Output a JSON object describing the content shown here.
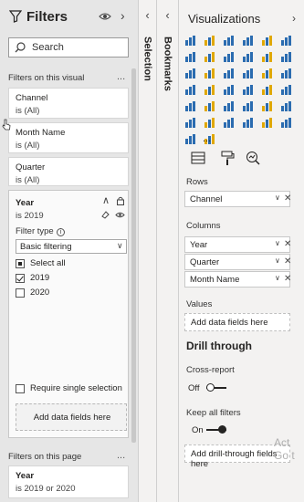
{
  "filters": {
    "title": "Filters",
    "search_placeholder": "Search",
    "section_visual": "Filters on this visual",
    "more": "...",
    "cards": [
      {
        "name": "Channel",
        "value": "is (All)"
      },
      {
        "name": "Month Name",
        "value": "is (All)"
      },
      {
        "name": "Quarter",
        "value": "is (All)"
      }
    ],
    "year": {
      "name": "Year",
      "value": "is 2019",
      "filter_type_label": "Filter type",
      "filter_type_value": "Basic filtering",
      "options": [
        {
          "label": "Select all",
          "state": "partial"
        },
        {
          "label": "2019",
          "state": "checked"
        },
        {
          "label": "2020",
          "state": "unchecked"
        }
      ],
      "require_single": "Require single selection",
      "add_fields": "Add data fields here"
    },
    "section_page": "Filters on this page",
    "page_card": {
      "name": "Year",
      "value": "is 2019 or 2020"
    }
  },
  "selection_label": "Selection",
  "bookmarks_label": "Bookmarks",
  "viz": {
    "title": "Visualizations",
    "more": "...",
    "rows_label": "Rows",
    "rows": [
      "Channel"
    ],
    "columns_label": "Columns",
    "columns": [
      "Year",
      "Quarter",
      "Month Name"
    ],
    "values_label": "Values",
    "values_placeholder": "Add data fields here",
    "drill_title": "Drill through",
    "cross_report_label": "Cross-report",
    "cross_report_state": "Off",
    "keep_filters_label": "Keep all filters",
    "keep_filters_state": "On",
    "drill_add": "Add drill-through fields here",
    "watermark_line1": "Act",
    "watermark_line2": "Go t"
  },
  "colors": {
    "accent": "#c8a000",
    "icon_blue": "#2b6cb0",
    "icon_gold": "#e0a800"
  }
}
